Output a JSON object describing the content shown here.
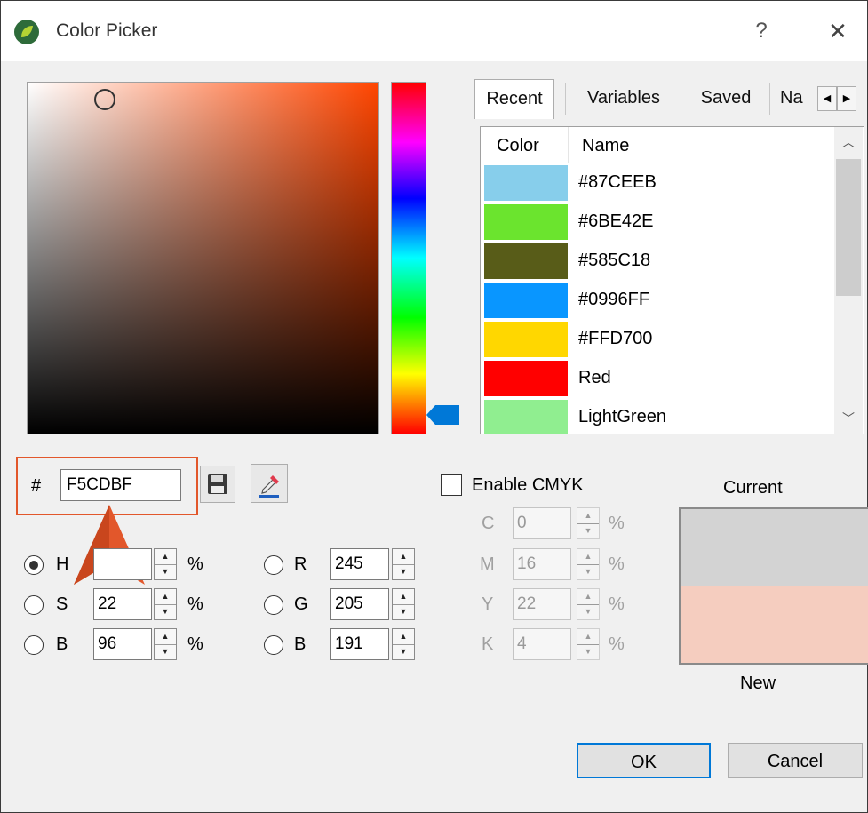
{
  "window": {
    "title": "Color Picker",
    "help": "?",
    "close": "✕"
  },
  "tabs": [
    {
      "label": "Recent"
    },
    {
      "label": "Variables"
    },
    {
      "label": "Saved"
    },
    {
      "label": "Na"
    }
  ],
  "list": {
    "header_color": "Color",
    "header_name": "Name",
    "rows": [
      {
        "name": "#87CEEB",
        "color": "#87CEEB"
      },
      {
        "name": "#6BE42E",
        "color": "#6BE42E"
      },
      {
        "name": "#585C18",
        "color": "#585C18"
      },
      {
        "name": "#0996FF",
        "color": "#0996FF"
      },
      {
        "name": "#FFD700",
        "color": "#FFD700"
      },
      {
        "name": "Red",
        "color": "#FF0000"
      },
      {
        "name": "LightGreen",
        "color": "#90EE90"
      }
    ]
  },
  "hex": {
    "prefix": "#",
    "value": "F5CDBF"
  },
  "hsb": {
    "h_label": "H",
    "s_label": "S",
    "b_label": "B",
    "h": "",
    "s": "22",
    "b": "96",
    "unit": "%",
    "selected": "H"
  },
  "rgb": {
    "r_label": "R",
    "g_label": "G",
    "b_label": "B",
    "r": "245",
    "g": "205",
    "b": "191"
  },
  "cmyk": {
    "enable_label": "Enable CMYK",
    "enabled": false,
    "c_label": "C",
    "m_label": "M",
    "y_label": "Y",
    "k_label": "K",
    "c": "0",
    "m": "16",
    "y": "22",
    "k": "4",
    "unit": "%"
  },
  "preview": {
    "current_label": "Current",
    "new_label": "New",
    "current_color": "#D3D3D3",
    "new_color": "#F5CDBF"
  },
  "buttons": {
    "ok": "OK",
    "cancel": "Cancel"
  },
  "colors": {
    "accent": "#0078D7",
    "highlight": "#E2572B",
    "hue_marker": "#0078D7"
  }
}
